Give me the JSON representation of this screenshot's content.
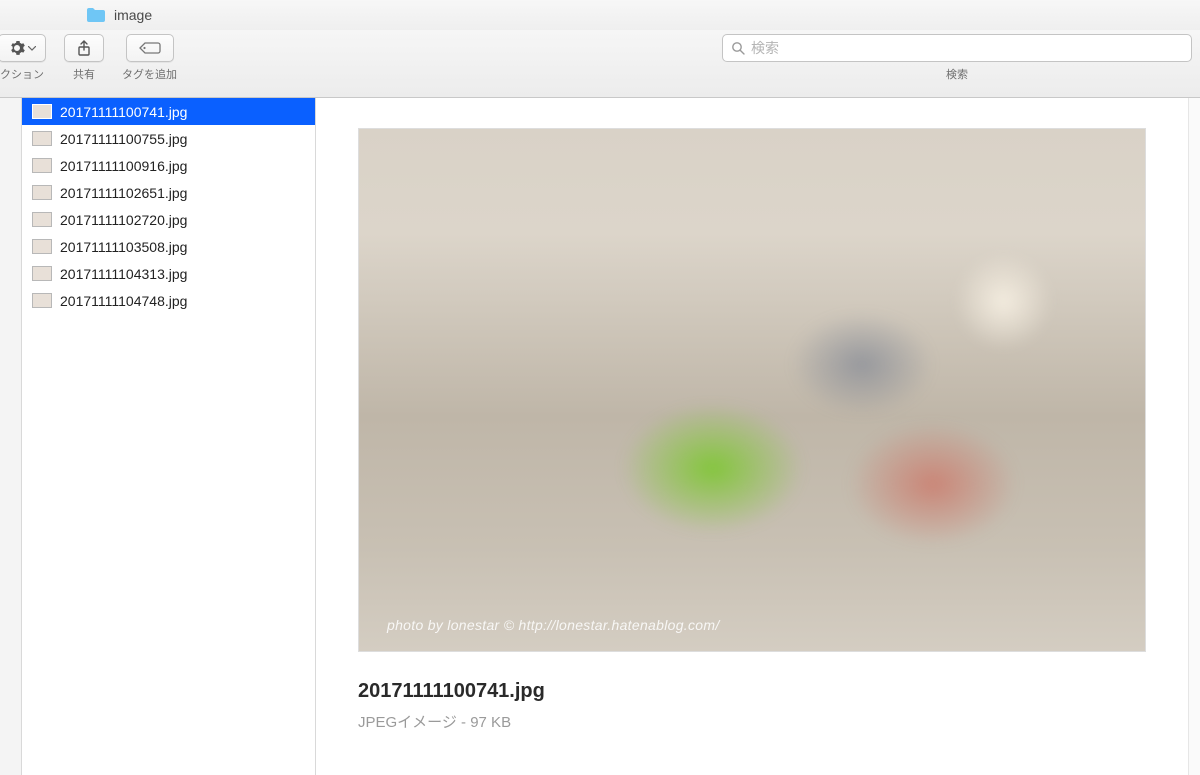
{
  "window": {
    "title": "image"
  },
  "toolbar": {
    "action_label": "クション",
    "share_label": "共有",
    "tags_label": "タグを追加",
    "search_label": "検索",
    "search_placeholder": "検索"
  },
  "files": [
    {
      "name": "20171111100741.jpg",
      "selected": true
    },
    {
      "name": "20171111100755.jpg",
      "selected": false
    },
    {
      "name": "20171111100916.jpg",
      "selected": false
    },
    {
      "name": "20171111102651.jpg",
      "selected": false
    },
    {
      "name": "20171111102720.jpg",
      "selected": false
    },
    {
      "name": "20171111103508.jpg",
      "selected": false
    },
    {
      "name": "20171111104313.jpg",
      "selected": false
    },
    {
      "name": "20171111104748.jpg",
      "selected": false
    }
  ],
  "preview": {
    "title": "20171111100741.jpg",
    "meta": "JPEGイメージ - 97 KB",
    "watermark": "photo by lonestar © http://lonestar.hatenablog.com/"
  }
}
